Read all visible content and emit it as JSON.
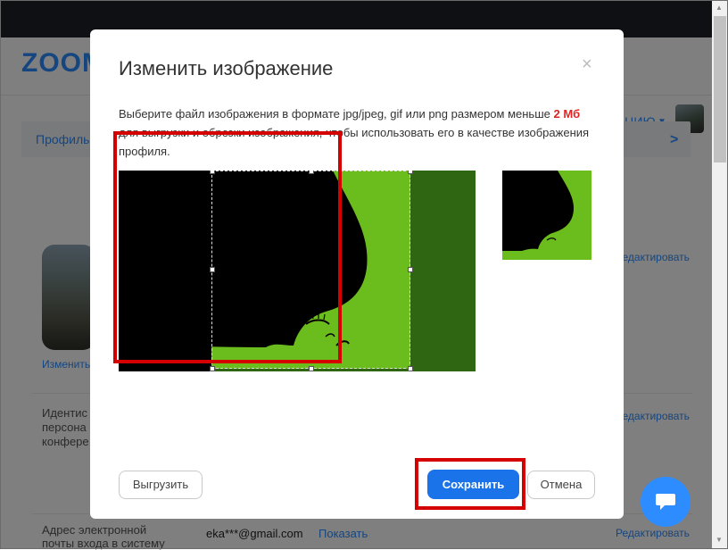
{
  "page": {
    "logo": "ZOOM",
    "account_label": "ИЦИЮ",
    "nav_profile": "Профиль",
    "change_link": "Изменить",
    "identity_text": [
      "Идентис",
      "персона",
      "конфере"
    ],
    "edit_label": "Редактировать",
    "email_label": [
      "Адрес электронной",
      "почты входа в систему"
    ],
    "email_value": "eka***@gmail.com",
    "show_label": "Показать"
  },
  "modal": {
    "title": "Изменить изображение",
    "close_symbol": "×",
    "desc_part1": "Выберите файл изображения в формате jpg/jpeg, gif или png размером меньше ",
    "desc_highlight": "2 Мб",
    "desc_part2": " для выгрузки и обрезки изображения, чтобы использовать его в качестве изображения профиля.",
    "upload_label": "Выгрузить",
    "save_label": "Сохранить",
    "cancel_label": "Отмена"
  },
  "colors": {
    "accent": "#2d8cff",
    "save_button": "#1a73e8",
    "highlight_red": "#d40000",
    "image_green": "#6bbd1e",
    "image_dark_green": "#2f6612"
  },
  "icons": [
    "close-icon",
    "chat-icon",
    "chevron-right-icon",
    "caret-down-icon"
  ]
}
